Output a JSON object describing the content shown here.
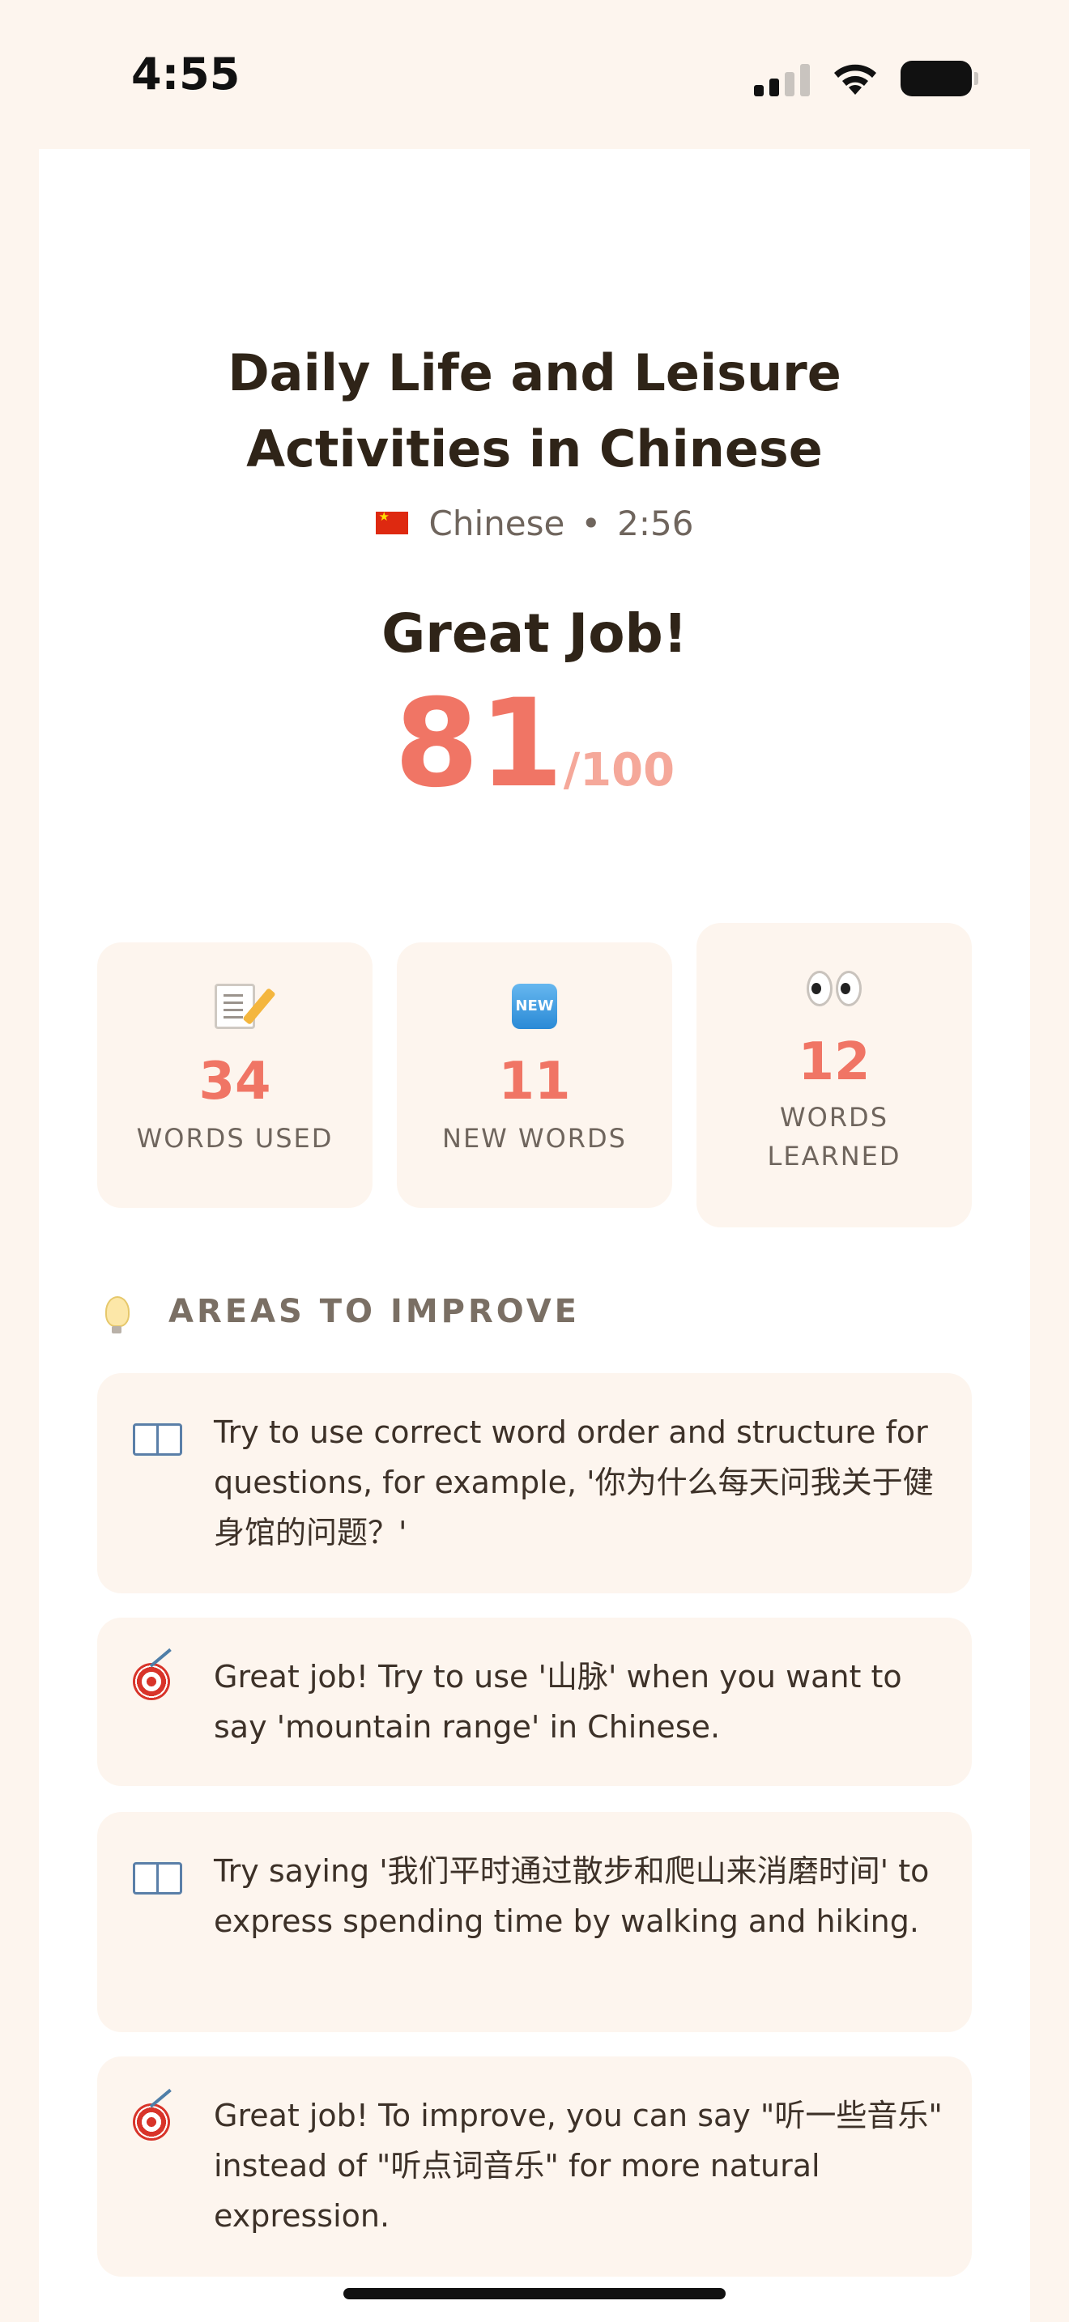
{
  "status_bar": {
    "time": "4:55"
  },
  "lesson": {
    "title": "Daily Life and Leisure Activities in Chinese",
    "language": "Chinese",
    "duration": "2:56",
    "separator": "•"
  },
  "result": {
    "headline": "Great Job!",
    "score": "81",
    "score_max": "/100"
  },
  "stats": [
    {
      "icon": "memo-icon",
      "value": "34",
      "label": "WORDS USED"
    },
    {
      "icon": "new-icon",
      "icon_text": "NEW",
      "value": "11",
      "label": "NEW WORDS"
    },
    {
      "icon": "eyes-icon",
      "value": "12",
      "label": "WORDS LEARNED"
    }
  ],
  "improve": {
    "title": "AREAS TO IMPROVE",
    "items": [
      {
        "icon": "book-icon",
        "text": "Try to use correct word order and structure for questions, for example, '你为什么每天问我关于健身馆的问题？'"
      },
      {
        "icon": "target-icon",
        "text": "Great job! Try to use '山脉' when you want to say 'mountain range' in Chinese."
      },
      {
        "icon": "book-icon",
        "text": "Try saying '我们平时通过散步和爬山来消磨时间' to express spending time by walking and hiking."
      },
      {
        "icon": "target-icon",
        "text": "Great job! To improve, you can say \"听一些音乐\" instead of \"听点词音乐\" for more natural expression."
      }
    ]
  },
  "colors": {
    "accent": "#f07565",
    "background": "#fdf5ee",
    "card": "#ffffff",
    "text": "#2f2418"
  }
}
